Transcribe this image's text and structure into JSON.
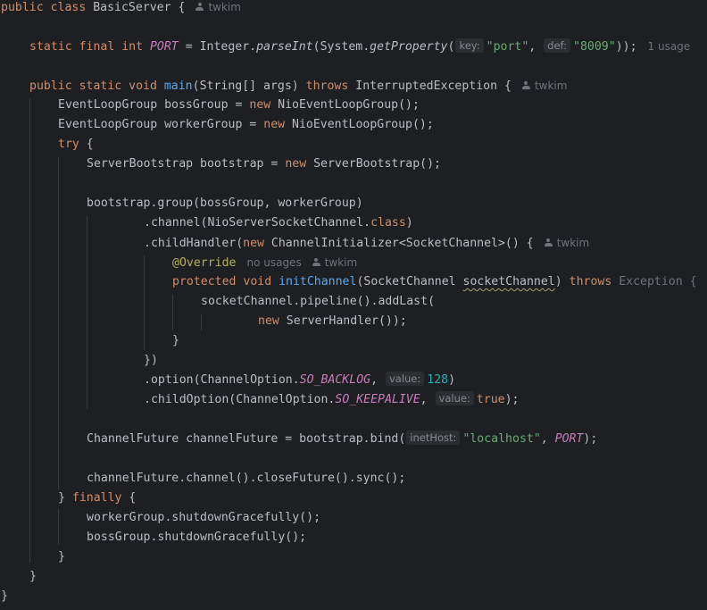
{
  "editor": {
    "author": "twkim",
    "usage_one": "1 usage",
    "usage_none": "no usages",
    "hints": {
      "key": "key:",
      "def": "def:",
      "value": "value:",
      "inet_host": "inetHost:"
    },
    "code": {
      "l1_a": "public class ",
      "l1_b": "BasicServer {",
      "l3_a": "static final int ",
      "l3_b": "PORT",
      "l3_c": " = Integer.",
      "l3_d": "parseInt",
      "l3_e": "(System.",
      "l3_f": "getProperty",
      "l3_g": "(",
      "l3_h": "\"port\"",
      "l3_i": ", ",
      "l3_j": "\"8009\"",
      "l3_k": "));",
      "l5_a": "public static void ",
      "l5_b": "main",
      "l5_c": "(String[] args) ",
      "l5_d": "throws",
      "l5_e": " InterruptedException {",
      "l6_a": "EventLoopGroup bossGroup = ",
      "l6_b": "new",
      "l6_c": " NioEventLoopGroup();",
      "l7_a": "EventLoopGroup workerGroup = ",
      "l7_b": "new",
      "l7_c": " NioEventLoopGroup();",
      "l8_a": "try",
      "l8_b": " {",
      "l9_a": "ServerBootstrap bootstrap = ",
      "l9_b": "new",
      "l9_c": " ServerBootstrap();",
      "l11": "bootstrap.group(bossGroup, workerGroup)",
      "l12_a": ".channel(NioServerSocketChannel.",
      "l12_b": "class",
      "l12_c": ")",
      "l13_a": ".childHandler(",
      "l13_b": "new",
      "l13_c": " ChannelInitializer<SocketChannel>() {",
      "l14": "@Override",
      "l15_a": "protected void ",
      "l15_b": "initChannel",
      "l15_c": "(SocketChannel ",
      "l15_d": "socketChannel",
      "l15_e": ") ",
      "l15_f": "throws",
      "l15_g": " Exception {",
      "l16": "socketChannel.pipeline().addLast(",
      "l17_a": "new",
      "l17_b": " ServerHandler());",
      "l18": "}",
      "l19": "})",
      "l20_a": ".option(ChannelOption.",
      "l20_b": "SO_BACKLOG",
      "l20_c": ", ",
      "l20_d": "128",
      "l20_e": ")",
      "l21_a": ".childOption(ChannelOption.",
      "l21_b": "SO_KEEPALIVE",
      "l21_c": ", ",
      "l21_d": "true",
      "l21_e": ");",
      "l23_a": "ChannelFuture channelFuture = bootstrap.bind(",
      "l23_b": "\"localhost\"",
      "l23_c": ", ",
      "l23_d": "PORT",
      "l23_e": ");",
      "l25": "channelFuture.channel().closeFuture().sync();",
      "l26_a": "} ",
      "l26_b": "finally",
      "l26_c": " {",
      "l27": "workerGroup.shutdownGracefully();",
      "l28": "bossGroup.shutdownGracefully();",
      "l29": "}",
      "l30": "}",
      "l31": "}"
    }
  }
}
